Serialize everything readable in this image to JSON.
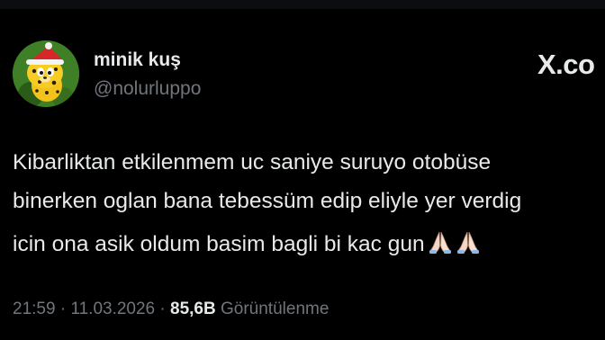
{
  "author": {
    "display_name": "minik kuş",
    "handle": "@nolurluppo",
    "avatar_icon": "cartoon-leopard-santa-hat-avatar"
  },
  "brand": {
    "logo_text": "X.co"
  },
  "tweet": {
    "lines": [
      "Kibarliktan etkilenmem uc saniye suruyo otobüse",
      "binerken oglan bana tebessüm edip eliyle yer verdig",
      "icin ona asik oldum basim bagli bi kac gun"
    ],
    "emojis": [
      "folded-hands-icon",
      "folded-hands-icon"
    ]
  },
  "meta": {
    "time": "21:59",
    "separator": "·",
    "date": "11.03.2026",
    "views_count": "85,6B",
    "views_label": "Görüntülenme"
  },
  "colors": {
    "background": "#000000",
    "primary_text": "#e7e9ea",
    "secondary_text": "#71767b"
  }
}
